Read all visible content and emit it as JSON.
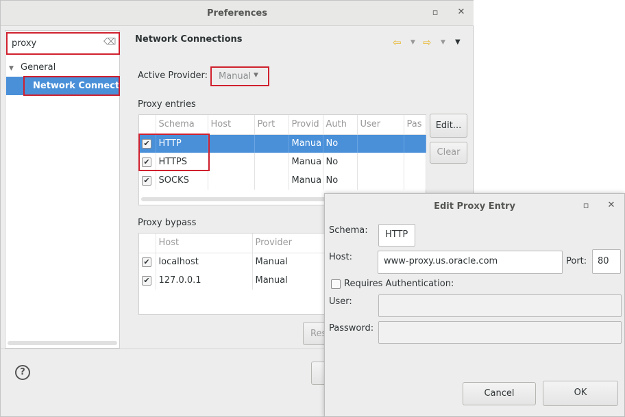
{
  "preferences": {
    "title": "Preferences",
    "search_value": "proxy",
    "tree": {
      "parent": "General",
      "child": "Network Connectio"
    },
    "page_title": "Network Connections",
    "active_provider_label": "Active Provider:",
    "active_provider_value": "Manual",
    "proxy_entries_label": "Proxy entries",
    "entries_columns": [
      "Schema",
      "Host",
      "Port",
      "Provid",
      "Auth",
      "User",
      "Pas"
    ],
    "entries": [
      {
        "schema": "HTTP",
        "host": "",
        "port": "",
        "provider": "Manua",
        "auth": "No",
        "user": "",
        "password": ""
      },
      {
        "schema": "HTTPS",
        "host": "",
        "port": "",
        "provider": "Manua",
        "auth": "No",
        "user": "",
        "password": ""
      },
      {
        "schema": "SOCKS",
        "host": "",
        "port": "",
        "provider": "Manua",
        "auth": "No",
        "user": "",
        "password": ""
      }
    ],
    "edit_button": "Edit...",
    "clear_button": "Clear",
    "proxy_bypass_label": "Proxy bypass",
    "bypass_columns": [
      "Host",
      "Provider"
    ],
    "bypass": [
      {
        "host": "localhost",
        "provider": "Manual"
      },
      {
        "host": "127.0.0.1",
        "provider": "Manual"
      }
    ],
    "restore_button_partial": "Res",
    "help_icon": "question-circle-icon"
  },
  "dialog": {
    "title": "Edit Proxy Entry",
    "schema_label": "Schema:",
    "schema_value": "HTTP",
    "host_label": "Host:",
    "host_value": "www-proxy.us.oracle.com",
    "port_label": "Port:",
    "port_value": "80",
    "requires_auth_label": "Requires Authentication:",
    "user_label": "User:",
    "user_value": "",
    "password_label": "Password:",
    "password_value": "",
    "cancel_button": "Cancel",
    "ok_button": "OK"
  },
  "colors": {
    "selection": "#4a90d9",
    "highlight_border": "#d0202e",
    "nav_arrow": "#e8b830"
  }
}
